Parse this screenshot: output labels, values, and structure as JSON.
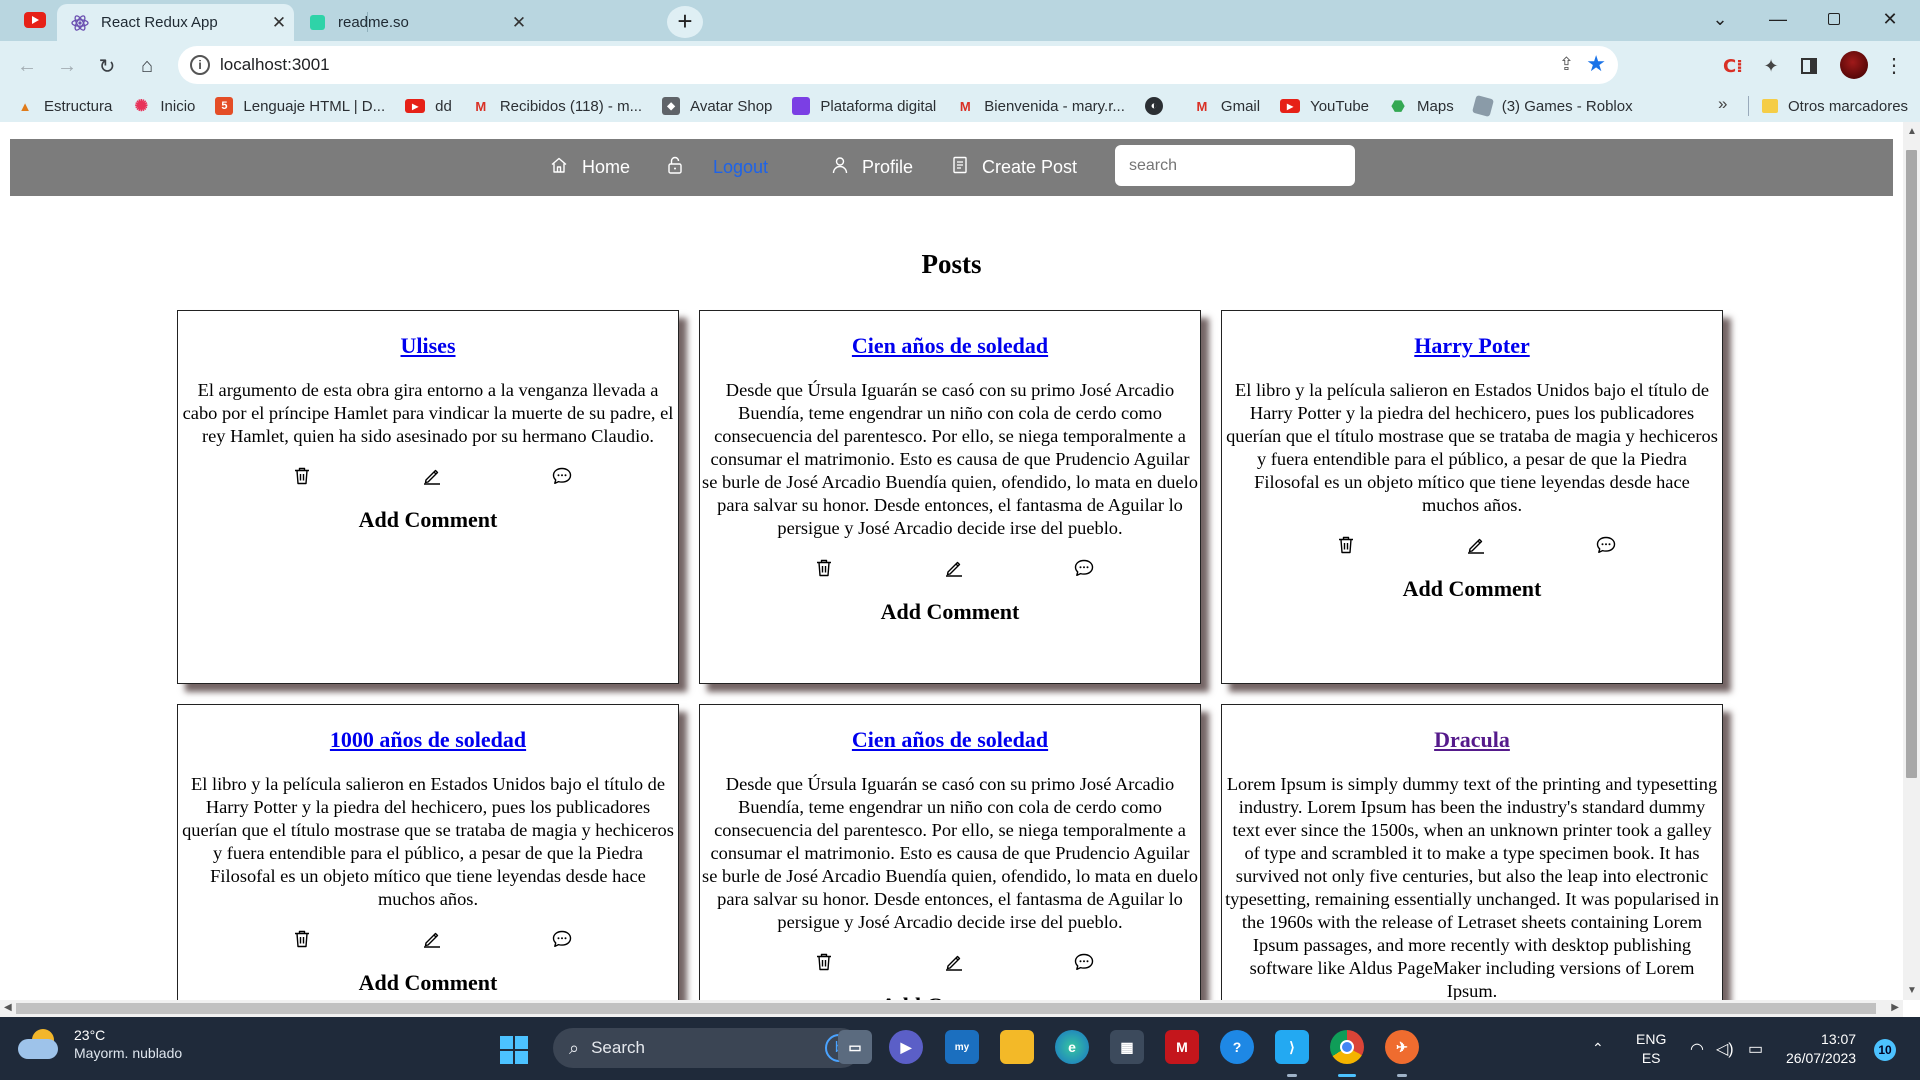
{
  "browser": {
    "tabs": [
      {
        "title": "React Redux App",
        "icon": "react-icon",
        "active": true
      },
      {
        "title": "readme.so",
        "icon": "readme-icon",
        "active": false
      }
    ],
    "address": "localhost:3001",
    "bookmarks": [
      {
        "label": "Estructura",
        "icon": "pma-icon",
        "color": "#e07b1a"
      },
      {
        "label": "Inicio",
        "icon": "flower-icon",
        "color": "#e8335a"
      },
      {
        "label": "Lenguaje HTML | D...",
        "icon": "html5-icon",
        "color": "#e44d26"
      },
      {
        "label": "dd",
        "icon": "youtube-icon",
        "color": "#e62117"
      },
      {
        "label": "Recibidos (118) - m...",
        "icon": "gmail-icon",
        "color": "#d93025"
      },
      {
        "label": "Avatar Shop",
        "icon": "avatar-shop-icon",
        "color": "#5f6368"
      },
      {
        "label": "Plataforma digital",
        "icon": "platform-icon",
        "color": "#7b3fe4"
      },
      {
        "label": "Bienvenida - mary.r...",
        "icon": "gmail-icon",
        "color": "#d93025"
      },
      {
        "label": "",
        "icon": "globe-icon",
        "color": "#2b2f33"
      },
      {
        "label": "Gmail",
        "icon": "gmail-icon",
        "color": "#d93025"
      },
      {
        "label": "YouTube",
        "icon": "youtube-icon",
        "color": "#e62117"
      },
      {
        "label": "Maps",
        "icon": "maps-icon",
        "color": "#34a853"
      },
      {
        "label": "(3) Games - Roblox",
        "icon": "roblox-icon",
        "color": "#8a9ba8"
      }
    ],
    "more": "»",
    "other_bookmarks": "Otros marcadores"
  },
  "nav": {
    "home": "Home",
    "logout": "Logout",
    "profile": "Profile",
    "create_post": "Create Post",
    "search_placeholder": "search"
  },
  "page": {
    "heading": "Posts",
    "add_comment": "Add Comment"
  },
  "posts": [
    {
      "title": "Ulises",
      "visited": false,
      "body": "El argumento de esta obra gira entorno a la venganza llevada a cabo por el príncipe Hamlet para vindicar la muerte de su padre, el rey Hamlet, quien ha sido asesinado por su hermano Claudio."
    },
    {
      "title": "Cien años de soledad",
      "visited": false,
      "body": "Desde que Úrsula Iguarán se casó con su primo José Arcadio Buendía, teme engendrar un niño con cola de cerdo como consecuencia del parentesco. Por ello, se niega temporalmente a consumar el matrimonio. Esto es causa de que Prudencio Aguilar se burle de José Arcadio Buendía quien, ofendido, lo mata en duelo para salvar su honor. Desde entonces, el fantasma de Aguilar lo persigue y José Arcadio decide irse del pueblo."
    },
    {
      "title": "Harry Poter",
      "visited": false,
      "body": "El libro y la película salieron en Estados Unidos bajo el título de Harry Potter y la piedra del hechicero, pues los publicadores querían que el título mostrase que se trataba de magia y hechiceros y fuera entendible para el público, a pesar de que la Piedra Filosofal es un objeto mítico que tiene leyendas desde hace muchos años."
    },
    {
      "title": "1000 años de soledad",
      "visited": false,
      "body": "El libro y la película salieron en Estados Unidos bajo el título de Harry Potter y la piedra del hechicero, pues los publicadores querían que el título mostrase que se trataba de magia y hechiceros y fuera entendible para el público, a pesar de que la Piedra Filosofal es un objeto mítico que tiene leyendas desde hace muchos años."
    },
    {
      "title": "Cien años de soledad",
      "visited": false,
      "body": "Desde que Úrsula Iguarán se casó con su primo José Arcadio Buendía, teme engendrar un niño con cola de cerdo como consecuencia del parentesco. Por ello, se niega temporalmente a consumar el matrimonio. Esto es causa de que Prudencio Aguilar se burle de José Arcadio Buendía quien, ofendido, lo mata en duelo para salvar su honor. Desde entonces, el fantasma de Aguilar lo persigue y José Arcadio decide irse del pueblo."
    },
    {
      "title": "Dracula",
      "visited": true,
      "body": "Lorem Ipsum is simply dummy text of the printing and typesetting industry. Lorem Ipsum has been the industry's standard dummy text ever since the 1500s, when an unknown printer took a galley of type and scrambled it to make a type specimen book. It has survived not only five centuries, but also the leap into electronic typesetting, remaining essentially unchanged. It was popularised in the 1960s with the release of Letraset sheets containing Lorem Ipsum passages, and more recently with desktop publishing software like Aldus PageMaker including versions of Lorem Ipsum."
    }
  ],
  "taskbar": {
    "temperature": "23°C",
    "weather": "Mayorm. nublado",
    "search": "Search",
    "lang1": "ENG",
    "lang2": "ES",
    "time": "13:07",
    "date": "26/07/2023",
    "notifications": "10",
    "apps": [
      "file-manager-icon",
      "meet-icon",
      "mylap-icon",
      "file-explorer-icon",
      "edge-icon",
      "store-icon",
      "mcafee-icon",
      "jamboard-icon",
      "vscode-icon",
      "chrome-icon",
      "postman-icon"
    ]
  },
  "colors": {
    "nav_bg": "#7c7c7c",
    "logout_link": "#1e63e8",
    "link": "#0000ee",
    "visited_link": "#551a8b",
    "chrome_tab": "#b9d6e0",
    "chrome_toolbar": "#dfeff4"
  }
}
